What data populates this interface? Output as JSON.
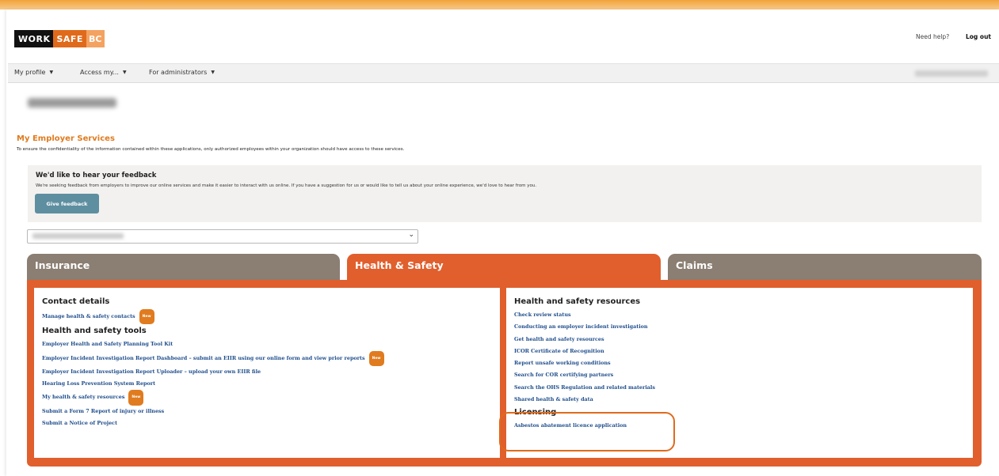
{
  "header": {
    "logo": {
      "part1": "WORK",
      "part2": "SAFE",
      "part3": "BC"
    },
    "help_link": "Need help?",
    "logout_link": "Log out"
  },
  "nav": {
    "items": [
      {
        "label": "My profile"
      },
      {
        "label": "Access my..."
      },
      {
        "label": "For administrators"
      }
    ]
  },
  "main": {
    "section_title": "My Employer Services",
    "section_description": "To ensure the confidentiality of the information contained within these applications, only authorized employees within your organization should have access to these services.",
    "feedback": {
      "title": "We'd like to hear your feedback",
      "text": "We're seeking feedback from employers to improve our online services and make it easier to interact with us online. If you have a suggestion for us or would like to tell us about your online experience, we'd love to hear from you.",
      "button_label": "Give feedback"
    }
  },
  "tabs": [
    {
      "label": "Insurance",
      "active": false
    },
    {
      "label": "Health & Safety",
      "active": true
    },
    {
      "label": "Claims",
      "active": false
    }
  ],
  "panel": {
    "left": {
      "contact_heading": "Contact details",
      "contact_links": [
        {
          "label": "Manage health & safety contacts",
          "badge": "New"
        }
      ],
      "tools_heading": "Health and safety tools",
      "tools_links": [
        {
          "label": "Employer Health and Safety Planning Tool Kit"
        },
        {
          "label": "Employer Incident Investigation Report Dashboard – submit an EIIR using our online form and view prior reports",
          "badge": "New"
        },
        {
          "label": "Employer Incident Investigation Report Uploader – upload your own EIIR file"
        },
        {
          "label": "Hearing Loss Prevention System Report"
        },
        {
          "label": "My health & safety resources",
          "badge": "New"
        },
        {
          "label": "Submit a Form 7 Report of injury or illness"
        },
        {
          "label": "Submit a Notice of Project"
        }
      ]
    },
    "right": {
      "resources_heading": "Health and safety resources",
      "resources_links": [
        {
          "label": "Check review status"
        },
        {
          "label": "Conducting an employer incident investigation"
        },
        {
          "label": "Get health and safety resources"
        },
        {
          "label": "ICOR Certificate of Recognition"
        },
        {
          "label": "Report unsafe working conditions"
        },
        {
          "label": "Search for COR certifying partners"
        },
        {
          "label": "Search the OHS Regulation and related materials"
        },
        {
          "label": "Shared health & safety data"
        }
      ],
      "licensing_heading": "Licensing",
      "licensing_links": [
        {
          "label": "Asbestos abatement licence application"
        }
      ]
    }
  },
  "colors": {
    "accent_orange": "#e05f2d",
    "tab_inactive": "#8b7e72",
    "link_blue": "#1e4d8c",
    "button_blue": "#5e8fa1",
    "badge_orange": "#e07b1f"
  }
}
